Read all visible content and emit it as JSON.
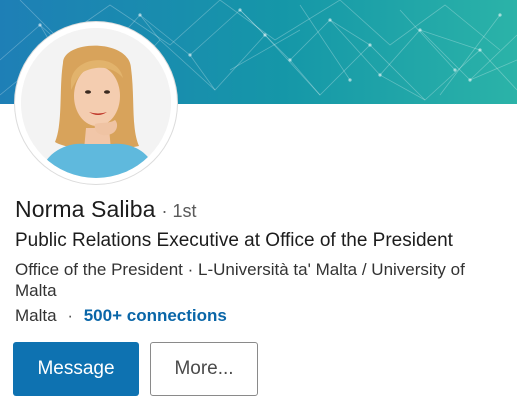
{
  "profile": {
    "name": "Norma Saliba",
    "degree_separator": "·",
    "degree": "1st",
    "headline": "Public Relations Executive at Office of the President",
    "organizations": "Office of the President · L-Università ta' Malta / University of Malta",
    "location": "Malta",
    "location_separator": "·",
    "connections": "500+ connections"
  },
  "actions": {
    "message_label": "Message",
    "more_label": "More..."
  },
  "colors": {
    "cover_gradient_start": "#1e7fb6",
    "cover_gradient_mid": "#1597a8",
    "cover_gradient_end": "#2bb3a8",
    "primary_button": "#0e72b1",
    "link": "#0a66a8",
    "avatar_top": "#60b8dc"
  },
  "icons": {
    "cover_pattern": "network-lines"
  }
}
